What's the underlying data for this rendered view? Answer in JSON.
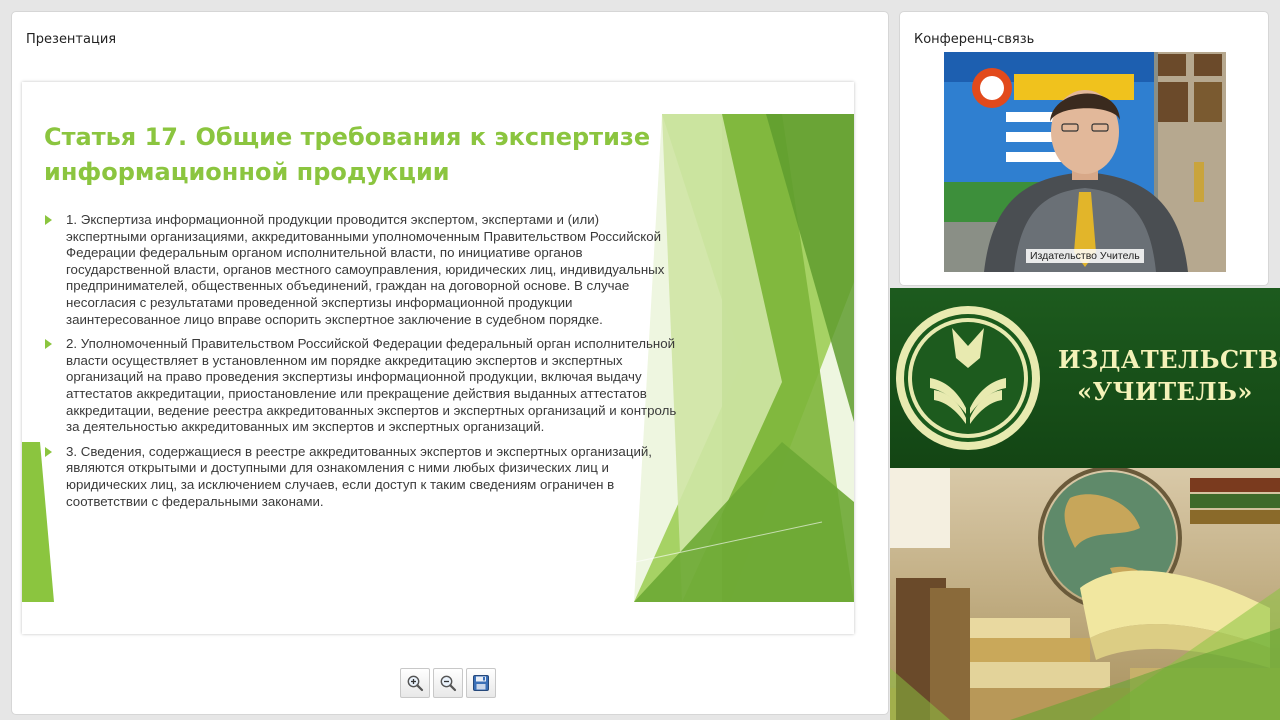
{
  "presentation": {
    "title": "Презентация",
    "slide": {
      "title": "Статья 17. Общие требования к экспертизе информационной продукции",
      "items": [
        "1. Экспертиза информационной продукции проводится экспертом, экспертами и (или) экспертными организациями, аккредитованными уполномоченным Правительством Российской Федерации федеральным органом исполнительной власти, по инициативе органов государственной власти, органов местного самоуправления, юридических лиц, индивидуальных предпринимателей, общественных объединений, граждан на договорной основе. В случае несогласия с результатами проведенной экспертизы информационной продукции заинтересованное лицо вправе оспорить экспертное заключение в судебном порядке.",
        "2. Уполномоченный Правительством Российской Федерации федеральный орган исполнительной власти осуществляет в установленном им порядке аккредитацию экспертов и экспертных организаций на право проведения экспертизы информационной продукции, включая выдачу аттестатов аккредитации, приостановление или прекращение действия выданных аттестатов аккредитации, ведение реестра аккредитованных экспертов и экспертных организаций и контроль за деятельностью аккредитованных им экспертов и экспертных организаций.",
        "3. Сведения, содержащиеся в реестре аккредитованных экспертов и экспертных организаций, являются открытыми и доступными для ознакомления с ними любых физических лиц и юридических лиц, за исключением случаев, если доступ к таким сведениям ограничен в соответствии с федеральными законами."
      ]
    },
    "toolbar": {
      "zoom_in_icon": "zoom-in-icon",
      "zoom_out_icon": "zoom-out-icon",
      "save_icon": "floppy-disk-icon"
    }
  },
  "conference": {
    "title": "Конференц-связь",
    "speaker_label": "Издательство Учитель"
  },
  "brand": {
    "name_line1": "ИЗДАТЕЛЬСТВО",
    "name_line2": "«УЧИТЕЛЬ»",
    "colors": {
      "accent_green": "#8bc53f",
      "banner_green": "#1d5b1e",
      "banner_text": "#f4f2b8"
    }
  }
}
